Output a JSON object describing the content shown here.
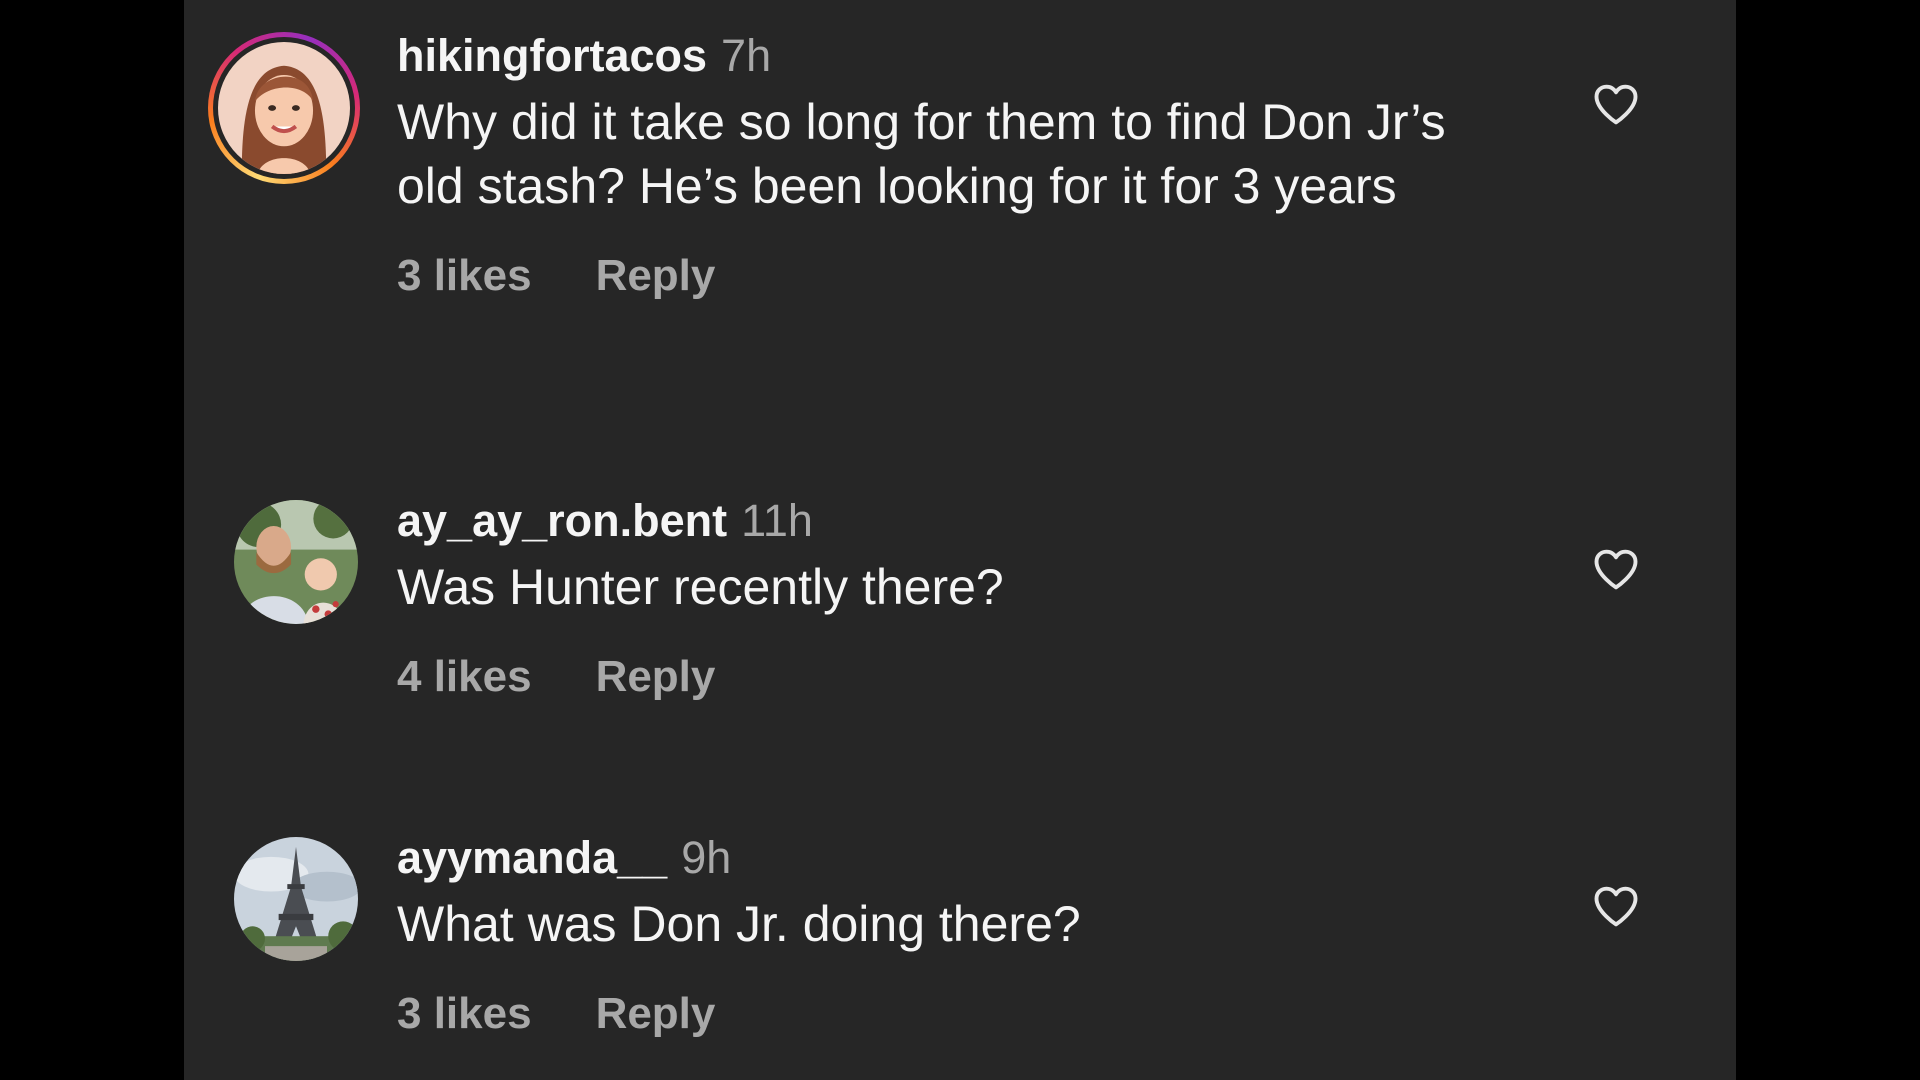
{
  "comments": [
    {
      "username": "hikingfortacos",
      "time": "7h",
      "text": "Why did it take so long for them to find Don Jr’s old stash? He’s been looking for it for 3 years",
      "likes": "3 likes",
      "reply_label": "Reply",
      "has_story_ring": true,
      "avatar": "cartoon-woman-avatar",
      "like_icon": "heart-outline-icon"
    },
    {
      "username": "ay_ay_ron.bent",
      "time": "11h",
      "text": "Was Hunter recently there?",
      "likes": "4 likes",
      "reply_label": "Reply",
      "has_story_ring": false,
      "avatar": "man-with-baby-photo-avatar",
      "like_icon": "heart-outline-icon"
    },
    {
      "username": "ayymanda__",
      "time": "9h",
      "text": "What was Don Jr. doing there?",
      "likes": "3 likes",
      "reply_label": "Reply",
      "has_story_ring": false,
      "avatar": "eiffel-tower-photo-avatar",
      "like_icon": "heart-outline-icon"
    }
  ],
  "colors": {
    "background": "#262626",
    "primary_text": "#f5f5f5",
    "secondary_text": "#a8a8a8",
    "letterbox": "#000000"
  }
}
